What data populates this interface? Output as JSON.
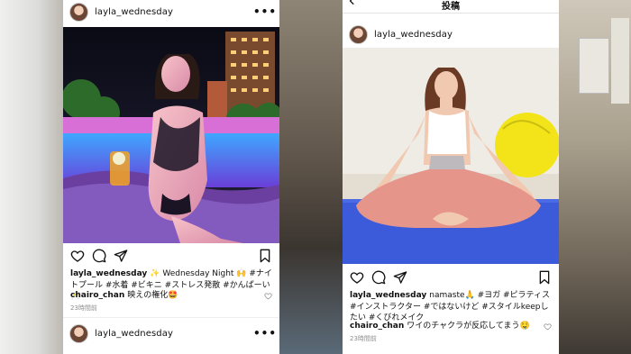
{
  "left_post": {
    "username": "layla_wednesday",
    "more": "•••",
    "caption_user": "layla_wednesday",
    "caption_text": "✨ Wednesday Night 🙌 #ナイトプール #水着 #ビキニ #ストレス発散 #かんぱーい🥂",
    "comment_user": "chairo_chan",
    "comment_text": "映えの権化🤩",
    "time": "23時間前"
  },
  "left_next_post": {
    "username": "layla_wednesday",
    "more": "•••"
  },
  "right_post": {
    "top_title": "投稿",
    "username": "layla_wednesday",
    "caption_user": "layla_wednesday",
    "caption_text": "namaste🙏 #ヨガ #ピラティス #インストラクター #ではないけど #スタイルkeepしたい #くびれメイク",
    "comment_user": "chairo_chan",
    "comment_text": "ワイのチャクラが反応してまう🤤",
    "time": "23時間前"
  },
  "colors": {
    "accent_blue": "#3b5bdb",
    "text": "#111111",
    "muted": "#8e8e8e"
  }
}
